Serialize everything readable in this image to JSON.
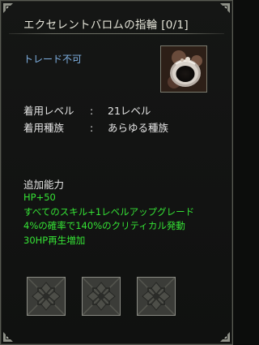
{
  "tooltip": {
    "title": "エクセレントバロムの指輪 [0/1]",
    "trade_status": "トレード不可",
    "item_icon": "ring-icon",
    "requirements": [
      {
        "label": "着用レベル",
        "separator": ":",
        "value": "21レベル"
      },
      {
        "label": "着用種族",
        "separator": ":",
        "value": "あらゆる種族"
      }
    ],
    "additional_title": "追加能力",
    "effects": [
      "HP+50",
      "すべてのスキル+1レベルアップグレード",
      "4%の確率で140%のクリティカル発動",
      "30HP再生増加"
    ],
    "sockets": [
      "empty-socket-icon",
      "empty-socket-icon",
      "empty-socket-icon"
    ]
  },
  "colors": {
    "background": "#121312",
    "border": "#585a52",
    "title_text": "#e4e4d8",
    "trade_text": "#7fb0e2",
    "info_text": "#e6e6e6",
    "effect_text": "#35e235",
    "socket_fill": "#3a3b37"
  }
}
